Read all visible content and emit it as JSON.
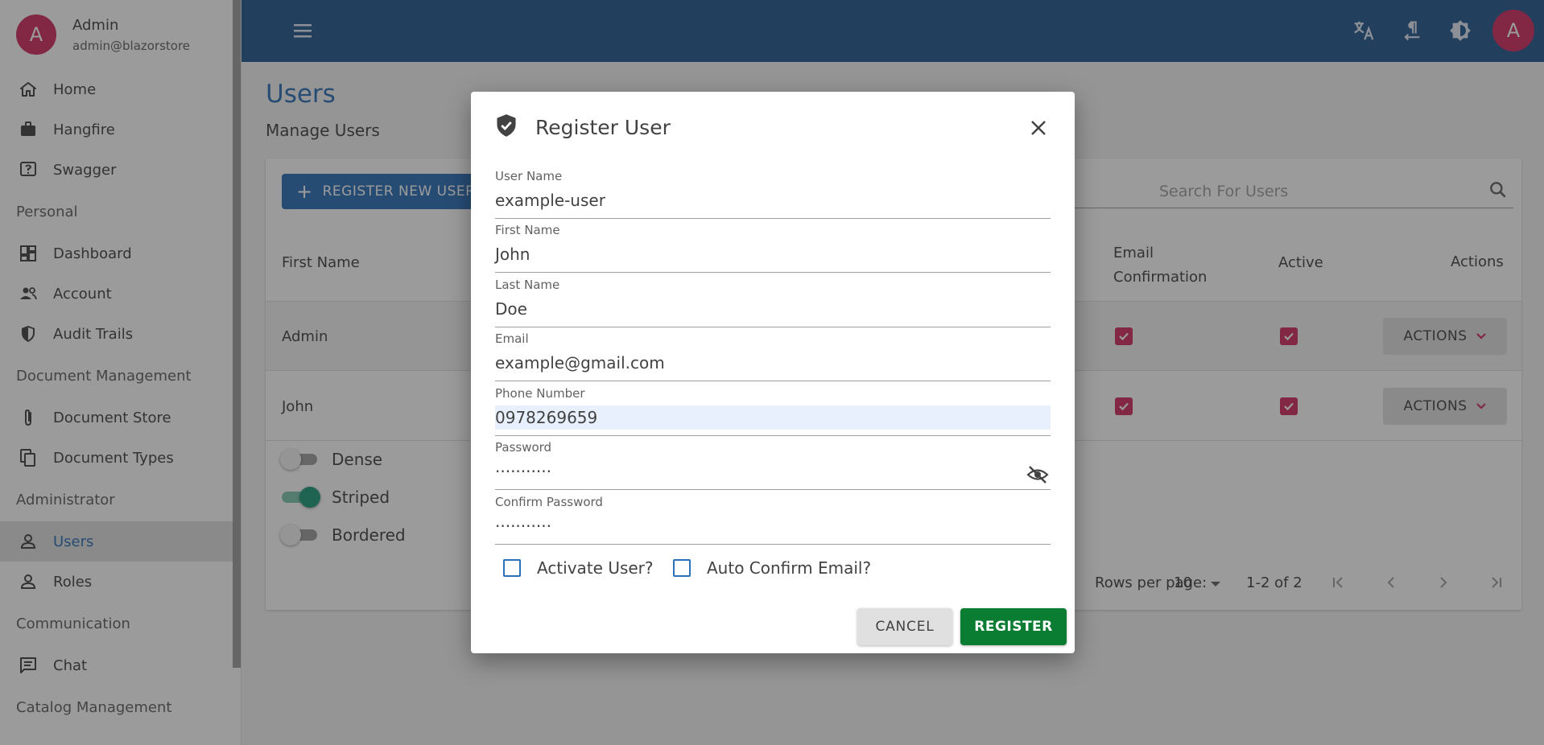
{
  "colors": {
    "primary": "#2d6fb8",
    "appbar": "#235a91",
    "avatar": "#d12c62",
    "register_button": "#0b7d33",
    "checkbox_checked": "#d12c62",
    "switch_on": "#1e9a7a"
  },
  "sidebar": {
    "user": {
      "avatar_letter": "A",
      "name": "Admin",
      "email": "admin@blazorstore"
    },
    "items_top": [
      {
        "label": "Home",
        "icon": "home-icon"
      },
      {
        "label": "Hangfire",
        "icon": "briefcase-icon"
      },
      {
        "label": "Swagger",
        "icon": "help-box-icon"
      }
    ],
    "group_personal": "Personal",
    "items_personal": [
      {
        "label": "Dashboard",
        "icon": "dashboard-icon"
      },
      {
        "label": "Account",
        "icon": "people-icon"
      },
      {
        "label": "Audit Trails",
        "icon": "shield-icon"
      }
    ],
    "group_docs": "Document Management",
    "items_docs": [
      {
        "label": "Document Store",
        "icon": "paperclip-icon"
      },
      {
        "label": "Document Types",
        "icon": "copy-icon"
      }
    ],
    "group_admin": "Administrator",
    "items_admin": [
      {
        "label": "Users",
        "icon": "person-icon"
      },
      {
        "label": "Roles",
        "icon": "person-icon"
      }
    ],
    "group_comm": "Communication",
    "items_comm": [
      {
        "label": "Chat",
        "icon": "chat-icon"
      }
    ],
    "group_catalog": "Catalog Management"
  },
  "appbar": {
    "avatar_letter": "A",
    "icons": [
      "menu-icon",
      "translate-icon",
      "text-direction-icon",
      "brightness-icon"
    ]
  },
  "page": {
    "title": "Users",
    "subtitle": "Manage Users",
    "register_new_label": "REGISTER NEW USER",
    "search_placeholder": "Search For Users",
    "table": {
      "headers": {
        "first_name": "First Name",
        "email_confirmation_1": "Email",
        "email_confirmation_2": "Confirmation",
        "active": "Active",
        "actions": "Actions"
      },
      "rows": [
        {
          "first_name": "Admin",
          "email_confirmed": true,
          "active": true,
          "actions_label": "ACTIONS"
        },
        {
          "first_name": "John",
          "email_confirmed": true,
          "active": true,
          "actions_label": "ACTIONS"
        }
      ]
    },
    "switches": [
      {
        "label": "Dense",
        "on": false
      },
      {
        "label": "Striped",
        "on": true
      },
      {
        "label": "Bordered",
        "on": false
      }
    ],
    "pager": {
      "rows_per_page_label": "Rows per page:",
      "rows_per_page": "10",
      "range": "1-2 of 2"
    }
  },
  "dialog": {
    "title": "Register User",
    "fields": {
      "user_name": {
        "label": "User Name",
        "value": "example-user"
      },
      "first_name": {
        "label": "First Name",
        "value": "John"
      },
      "last_name": {
        "label": "Last Name",
        "value": "Doe"
      },
      "email": {
        "label": "Email",
        "value": "example@gmail.com"
      },
      "phone": {
        "label": "Phone Number",
        "value": "0978269659"
      },
      "password": {
        "label": "Password",
        "value": "···········"
      },
      "confirm_password": {
        "label": "Confirm Password",
        "value": "···········"
      }
    },
    "activate_user_label": "Activate User?",
    "auto_confirm_label": "Auto Confirm Email?",
    "cancel_label": "CANCEL",
    "register_label": "REGISTER"
  }
}
